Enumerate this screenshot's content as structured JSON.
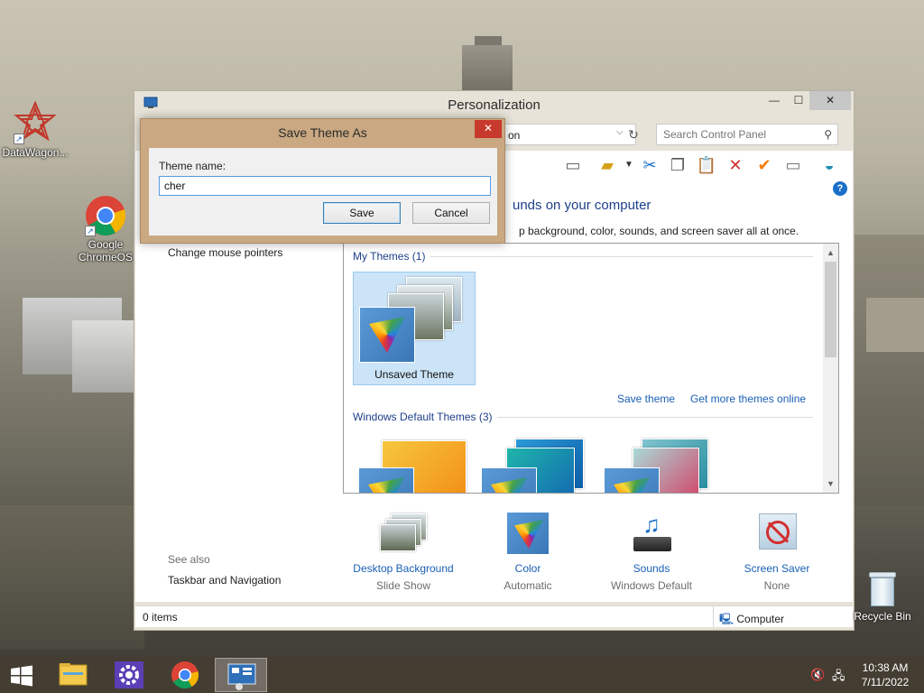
{
  "desktop": {
    "icons": [
      {
        "label": "DataWagon...",
        "icon": "datawagon-logo"
      },
      {
        "label": "Google ChromeOS",
        "icon": "chrome-icon"
      },
      {
        "label": "Recycle Bin",
        "icon": "recycle-bin-icon"
      }
    ]
  },
  "window": {
    "title": "Personalization",
    "address_text": "on",
    "search_placeholder": "Search Control Panel",
    "heading": "unds on your computer",
    "subheading": "p background, color, sounds, and screen saver all at once.",
    "left_links": [
      "Change mouse pointers"
    ],
    "see_also_label": "See also",
    "see_also_links": [
      "Taskbar and Navigation"
    ],
    "groups": {
      "my_themes": "My Themes (1)",
      "default_themes": "Windows Default Themes (3)"
    },
    "unsaved_theme_label": "Unsaved Theme",
    "save_theme_link": "Save theme",
    "get_more_link": "Get more themes online",
    "bottom_items": [
      {
        "label": "Desktop Background",
        "value": "Slide Show"
      },
      {
        "label": "Color",
        "value": "Automatic"
      },
      {
        "label": "Sounds",
        "value": "Windows Default"
      },
      {
        "label": "Screen Saver",
        "value": "None"
      }
    ],
    "status_left": "0 items",
    "status_right": "Computer"
  },
  "dialog": {
    "title": "Save Theme As",
    "field_label": "Theme name:",
    "field_value": "cher",
    "save_label": "Save",
    "cancel_label": "Cancel",
    "close_glyph": "✕"
  },
  "taskbar": {
    "time": "10:38 AM",
    "date": "7/11/2022"
  },
  "colors": {
    "link": "#1a5fb4",
    "heading": "#1e3f8a",
    "dialog_frame": "#c9a882",
    "dialog_close": "#c7392b",
    "selection": "#cce4f7"
  }
}
